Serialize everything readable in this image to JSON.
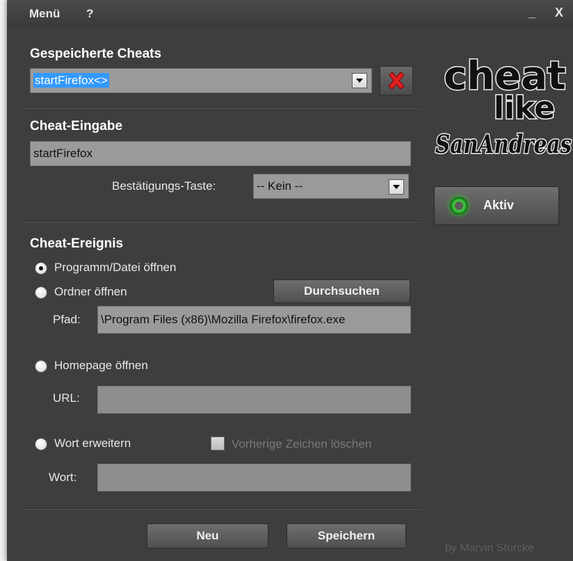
{
  "menu": {
    "menu_label": "Menü",
    "help_label": "?"
  },
  "window_controls": {
    "minimize": "_",
    "close": "X"
  },
  "saved_cheats": {
    "heading": "Gespeicherte Cheats",
    "selected_value": "startFirefox<>"
  },
  "cheat_input": {
    "heading": "Cheat-Eingabe",
    "value": "startFirefox",
    "confirm_key_label": "Bestätigungs-Taste:",
    "confirm_key_value": "-- Kein --"
  },
  "cheat_event": {
    "heading": "Cheat-Ereignis",
    "option_program": "Programm/Datei öffnen",
    "option_folder": "Ordner öffnen",
    "browse_button": "Durchsuchen",
    "path_label": "Pfad:",
    "path_value": "\\Program Files (x86)\\Mozilla Firefox\\firefox.exe",
    "option_homepage": "Homepage öffnen",
    "url_label": "URL:",
    "url_value": "",
    "option_word": "Wort erweitern",
    "delete_previous_label": "Vorherige Zeichen löschen",
    "word_label": "Wort:",
    "word_value": "",
    "selected_option": "program"
  },
  "logo": {
    "line1": "cheat",
    "line2": "like",
    "line3": "SanAndreas"
  },
  "status": {
    "label": "Aktiv",
    "state": "active",
    "led_color": "#2ec82e"
  },
  "footer": {
    "new_button": "Neu",
    "save_button": "Speichern",
    "credit": "by Marvin Stürcke"
  },
  "colors": {
    "window_bg": "#3e3e3e",
    "field_bg": "#9a9a9a",
    "selection": "#3399ff",
    "delete_red": "#e02020"
  }
}
